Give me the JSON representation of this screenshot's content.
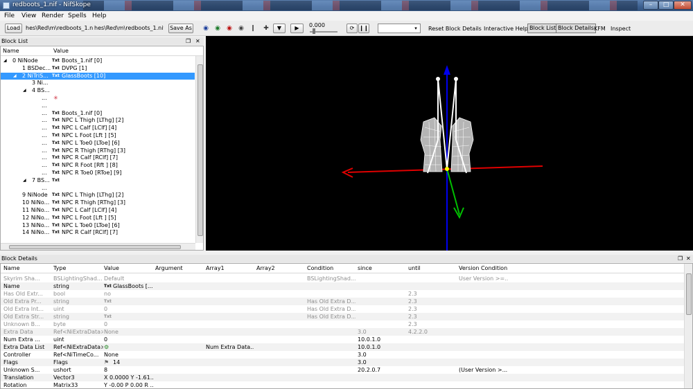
{
  "window": {
    "title": "redboots_1.nif - NifSkope"
  },
  "menu": [
    "File",
    "View",
    "Render",
    "Spells",
    "Help"
  ],
  "toolbar": {
    "load_label": "Load",
    "load_path": "hes\\Red\\m\\redboots_1.nif",
    "save_path": "hes\\Red\\m\\redboots_1.nif",
    "save_as_label": "Save As",
    "time_value": "0.000",
    "reset_block_details": "Reset Block Details",
    "interactive_help": "Interactive Help",
    "block_list": "Block List",
    "block_details": "Block Details",
    "kfm": "KFM",
    "inspect": "Inspect"
  },
  "block_list": {
    "title": "Block List",
    "columns": {
      "name": "Name",
      "value": "Value"
    },
    "rows": [
      {
        "indent": 0,
        "arrow": "◢",
        "name": "0 NiNode",
        "txt": "Txt",
        "value": "Boots_1.nif [0]"
      },
      {
        "indent": 1,
        "arrow": "",
        "name": "1 BSDec...",
        "txt": "Txt",
        "value": "DVPG [1]"
      },
      {
        "indent": 1,
        "arrow": "◢",
        "name": "2 NiTriS...",
        "txt": "Txt",
        "value": "GlassBoots [10]",
        "selected": true
      },
      {
        "indent": 2,
        "arrow": "",
        "name": "3 Ni...",
        "txt": "",
        "value": ""
      },
      {
        "indent": 2,
        "arrow": "◢",
        "name": "4 BS...",
        "txt": "",
        "value": ""
      },
      {
        "indent": 3,
        "arrow": "",
        "name": "...",
        "txt": "",
        "value": "",
        "icon": true
      },
      {
        "indent": 3,
        "arrow": "",
        "name": "...",
        "txt": "",
        "value": ""
      },
      {
        "indent": 3,
        "arrow": "",
        "name": "...",
        "txt": "Txt",
        "value": "Boots_1.nif [0]"
      },
      {
        "indent": 3,
        "arrow": "",
        "name": "...",
        "txt": "Txt",
        "value": "NPC L Thigh [LThg] [2]"
      },
      {
        "indent": 3,
        "arrow": "",
        "name": "...",
        "txt": "Txt",
        "value": "NPC L Calf [LClf] [4]"
      },
      {
        "indent": 3,
        "arrow": "",
        "name": "...",
        "txt": "Txt",
        "value": "NPC L Foot [Lft ] [5]"
      },
      {
        "indent": 3,
        "arrow": "",
        "name": "...",
        "txt": "Txt",
        "value": "NPC L Toe0 [LToe] [6]"
      },
      {
        "indent": 3,
        "arrow": "",
        "name": "...",
        "txt": "Txt",
        "value": "NPC R Thigh [RThg] [3]"
      },
      {
        "indent": 3,
        "arrow": "",
        "name": "...",
        "txt": "Txt",
        "value": "NPC R Calf [RClf] [7]"
      },
      {
        "indent": 3,
        "arrow": "",
        "name": "...",
        "txt": "Txt",
        "value": "NPC R Foot [Rft ] [8]"
      },
      {
        "indent": 3,
        "arrow": "",
        "name": "...",
        "txt": "Txt",
        "value": "NPC R Toe0 [RToe] [9]"
      },
      {
        "indent": 2,
        "arrow": "◢",
        "name": "7 BS...",
        "txt": "Txt",
        "value": ""
      },
      {
        "indent": 3,
        "arrow": "",
        "name": "...",
        "txt": "",
        "value": ""
      },
      {
        "indent": 1,
        "arrow": "",
        "name": "9 NiNode",
        "txt": "Txt",
        "value": "NPC L Thigh [LThg] [2]"
      },
      {
        "indent": 1,
        "arrow": "",
        "name": "10 NiNo...",
        "txt": "Txt",
        "value": "NPC R Thigh [RThg] [3]"
      },
      {
        "indent": 1,
        "arrow": "",
        "name": "11 NiNo...",
        "txt": "Txt",
        "value": "NPC L Calf [LClf] [4]"
      },
      {
        "indent": 1,
        "arrow": "",
        "name": "12 NiNo...",
        "txt": "Txt",
        "value": "NPC L Foot [Lft ] [5]"
      },
      {
        "indent": 1,
        "arrow": "",
        "name": "13 NiNo...",
        "txt": "Txt",
        "value": "NPC L Toe0 [LToe] [6]"
      },
      {
        "indent": 1,
        "arrow": "",
        "name": "14 NiNo...",
        "txt": "Txt",
        "value": "NPC R Calf [RClf] [7]"
      }
    ]
  },
  "block_details": {
    "title": "Block Details",
    "columns": [
      "Name",
      "Type",
      "Value",
      "Argument",
      "Array1",
      "Array2",
      "Condition",
      "since",
      "until",
      "Version Condition"
    ],
    "rows": [
      {
        "dim": true,
        "cells": [
          "Skyrim Sha...",
          "BSLightingShad...",
          "Default",
          "",
          "",
          "",
          "BSLightingShad...",
          "",
          "",
          "User Version >=..."
        ]
      },
      {
        "dim": false,
        "cells": [
          "Name",
          "string",
          "GlassBoots [...",
          "",
          "",
          "",
          "",
          "",
          "",
          ""
        ],
        "txt": true
      },
      {
        "dim": true,
        "cells": [
          "Has Old Extr...",
          "bool",
          "no",
          "",
          "",
          "",
          "",
          "",
          "2.3",
          ""
        ]
      },
      {
        "dim": true,
        "cells": [
          "Old Extra Pr...",
          "string",
          "",
          "",
          "",
          "",
          "Has Old Extra D...",
          "",
          "2.3",
          ""
        ],
        "txt": true
      },
      {
        "dim": true,
        "cells": [
          "Old Extra Int...",
          "uint",
          "0",
          "",
          "",
          "",
          "Has Old Extra D...",
          "",
          "2.3",
          ""
        ]
      },
      {
        "dim": true,
        "cells": [
          "Old Extra Str...",
          "string",
          "",
          "",
          "",
          "",
          "Has Old Extra D...",
          "",
          "2.3",
          ""
        ],
        "txt": true
      },
      {
        "dim": true,
        "cells": [
          "Unknown B...",
          "byte",
          "0",
          "",
          "",
          "",
          "",
          "",
          "2.3",
          ""
        ]
      },
      {
        "dim": true,
        "cells": [
          "Extra Data",
          "Ref<NiExtraData>",
          "None",
          "",
          "",
          "",
          "",
          "3.0",
          "4.2.2.0",
          ""
        ]
      },
      {
        "dim": false,
        "cells": [
          "Num Extra ...",
          "uint",
          "0",
          "",
          "",
          "",
          "",
          "10.0.1.0",
          "",
          ""
        ]
      },
      {
        "dim": false,
        "cells": [
          "Extra Data List",
          "Ref<NiExtraData>",
          "",
          "",
          "Num Extra Data...",
          "",
          "",
          "10.0.1.0",
          "",
          ""
        ],
        "gear": true
      },
      {
        "dim": false,
        "cells": [
          "Controller",
          "Ref<NiTimeCo...",
          "None",
          "",
          "",
          "",
          "",
          "3.0",
          "",
          ""
        ]
      },
      {
        "dim": false,
        "cells": [
          "Flags",
          "Flags",
          "14",
          "",
          "",
          "",
          "",
          "3.0",
          "",
          ""
        ],
        "flag": true
      },
      {
        "dim": false,
        "cells": [
          "Unknown S...",
          "ushort",
          "8",
          "",
          "",
          "",
          "",
          "20.2.0.7",
          "",
          "(User Version >..."
        ]
      },
      {
        "dim": false,
        "cells": [
          "Translation",
          "Vector3",
          "X 0.0000 Y -1.61...",
          "",
          "",
          "",
          "",
          "",
          "",
          ""
        ]
      },
      {
        "dim": false,
        "cells": [
          "Rotation",
          "Matrix33",
          "Y -0.00 P 0.00 R ...",
          "",
          "",
          "",
          "",
          "",
          "",
          ""
        ]
      }
    ]
  },
  "icons": {
    "dock_float": "❐",
    "dock_close": "✕",
    "play": "▶",
    "combo_arrow": "▾"
  },
  "colors": {
    "selection": "#3399ff",
    "viewport_bg": "#000000",
    "axis_x": "#e00000",
    "axis_y": "#00c000",
    "axis_z": "#0000ee"
  }
}
